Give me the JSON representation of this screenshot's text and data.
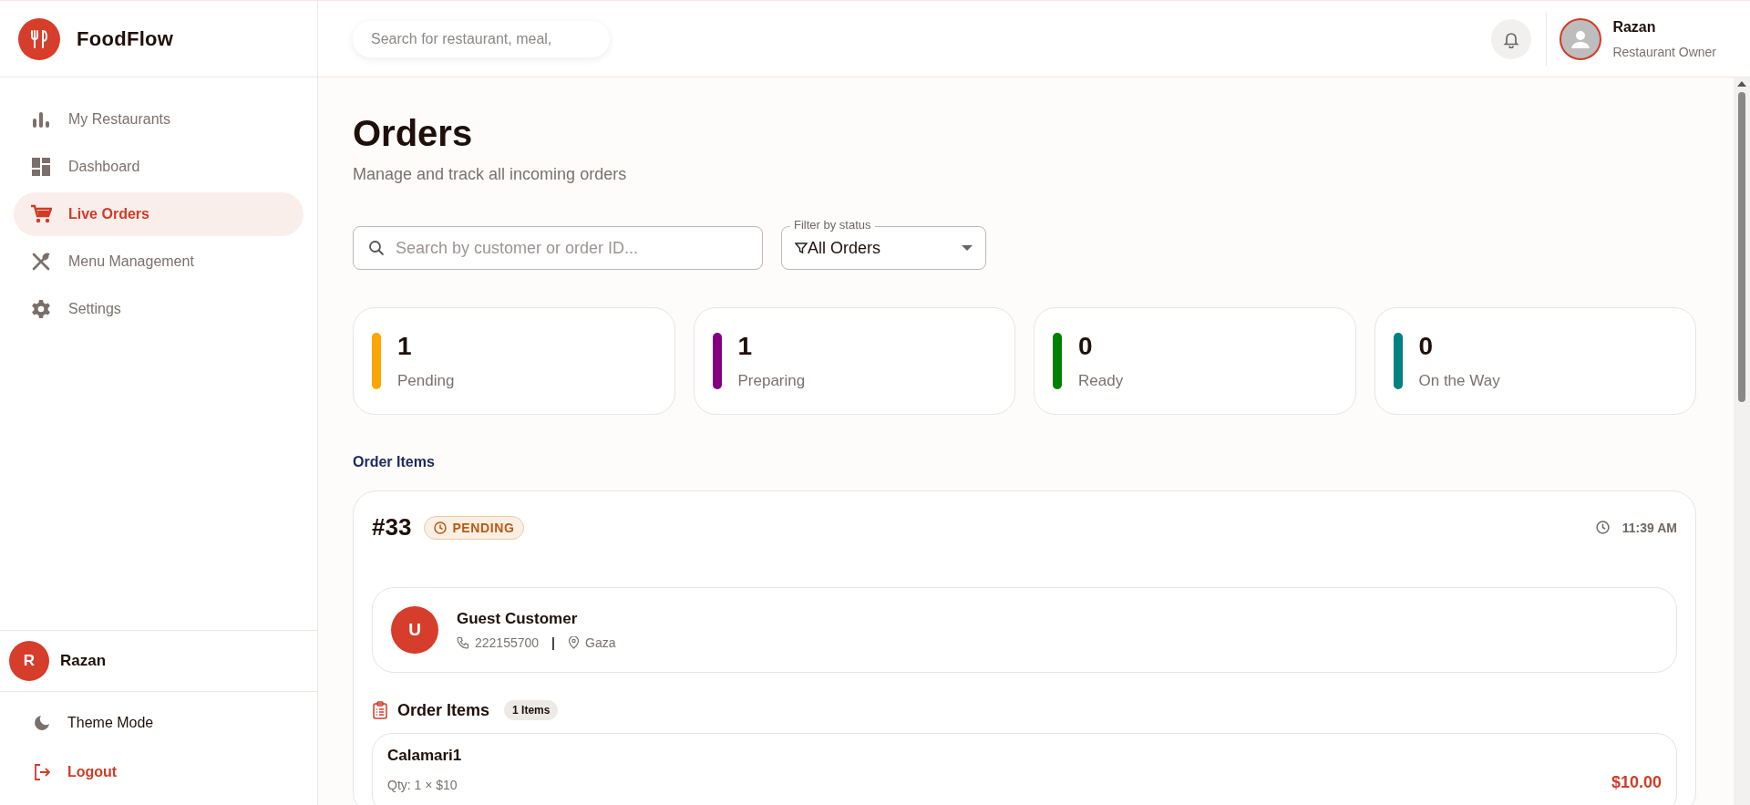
{
  "app": {
    "logo": "FoodFlow"
  },
  "sidebar": {
    "items": [
      {
        "label": "My Restaurants",
        "selected": false
      },
      {
        "label": "Dashboard",
        "selected": false
      },
      {
        "label": "Live Orders",
        "selected": true
      },
      {
        "label": "Menu Management",
        "selected": false
      },
      {
        "label": "Settings",
        "selected": false
      }
    ],
    "user": {
      "initial": "R",
      "name": "Razan"
    },
    "footer": [
      {
        "label": "Theme Mode",
        "kind": "theme"
      },
      {
        "label": "Logout",
        "kind": "logout"
      }
    ]
  },
  "header": {
    "search": {
      "placeholder": "Search for restaurant, meal,"
    },
    "user": {
      "name": "Razan",
      "role": "Restaurant Owner"
    }
  },
  "page": {
    "title": "Orders",
    "subtitle": "Manage and track all incoming orders",
    "search": {
      "placeholder": "Search by customer or order ID..."
    },
    "filter": {
      "label": "Filter by status",
      "value": "All Orders"
    },
    "stats": [
      {
        "count": "1",
        "label": "Pending",
        "color": "#ffa500"
      },
      {
        "count": "1",
        "label": "Preparing",
        "color": "#800080"
      },
      {
        "count": "0",
        "label": "Ready",
        "color": "#008000"
      },
      {
        "count": "0",
        "label": "On the Way",
        "color": "#008080"
      }
    ],
    "section_title": "Order Items",
    "order": {
      "number": "#33",
      "status": {
        "label": "PENDING",
        "kind": "pending"
      },
      "time": "11:39 AM",
      "customer": {
        "initial": "U",
        "name": "Guest Customer",
        "phone": "222155700",
        "separator": "|",
        "location": "Gaza"
      },
      "items_title": "Order Items",
      "items_count": "1 Items",
      "items": [
        {
          "name": "Calamari1",
          "qty": "Qty: 1 × $10",
          "price": "$10.00"
        }
      ]
    }
  }
}
